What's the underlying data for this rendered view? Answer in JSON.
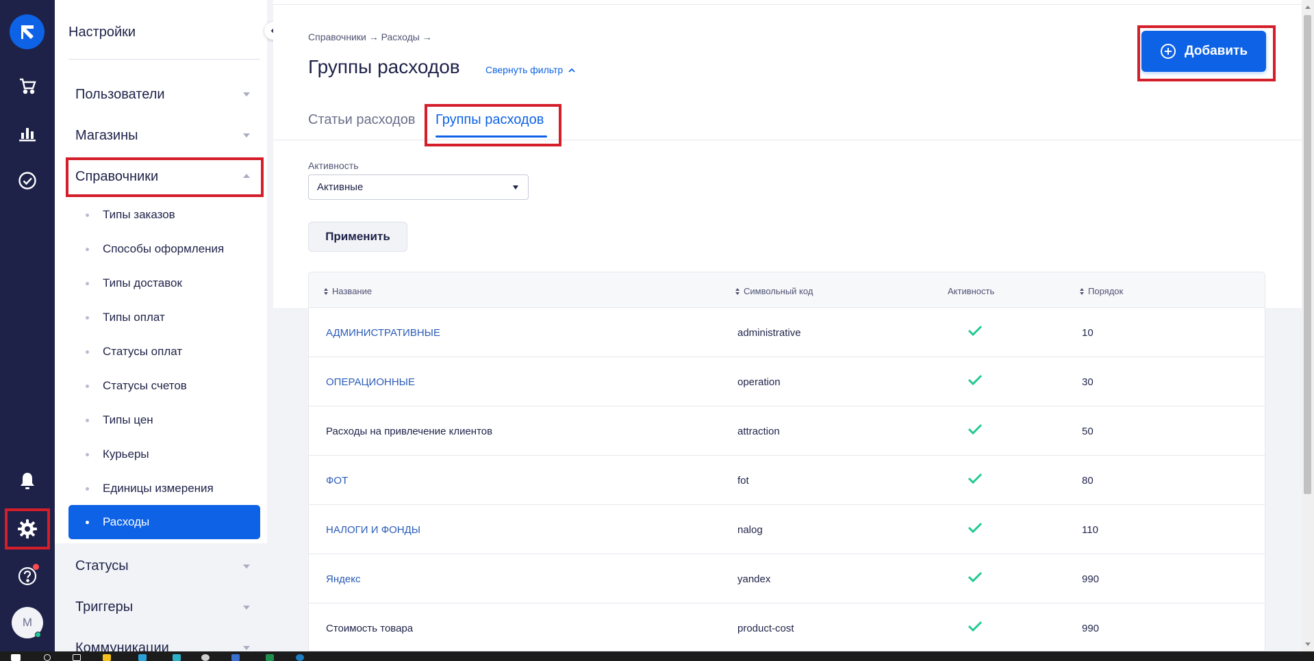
{
  "rail": {
    "items": [
      "logo-icon",
      "cart-icon",
      "chart-icon",
      "check-circle-icon",
      "bell-icon",
      "gear-icon",
      "help-icon"
    ],
    "avatar_initial": "M"
  },
  "sidebar": {
    "title": "Настройки",
    "sections": [
      {
        "label": "Пользователи",
        "expanded": false
      },
      {
        "label": "Магазины",
        "expanded": false
      },
      {
        "label": "Справочники",
        "expanded": true
      },
      {
        "label": "Статусы",
        "expanded": false
      },
      {
        "label": "Триггеры",
        "expanded": false
      },
      {
        "label": "Коммуникации",
        "expanded": false
      }
    ],
    "sub_items": [
      "Типы заказов",
      "Способы оформления",
      "Типы доставок",
      "Типы оплат",
      "Статусы оплат",
      "Статусы счетов",
      "Типы цен",
      "Курьеры",
      "Единицы измерения",
      "Расходы"
    ],
    "active_sub_item": "Расходы"
  },
  "header": {
    "breadcrumb": "Справочники → Расходы →",
    "title": "Группы расходов",
    "filter_toggle": "Свернуть фильтр",
    "add_button": "Добавить"
  },
  "tabs": [
    {
      "label": "Статьи расходов",
      "active": false
    },
    {
      "label": "Группы расходов",
      "active": true
    }
  ],
  "filter": {
    "label": "Активность",
    "selected": "Активные",
    "apply_button": "Применить"
  },
  "table": {
    "columns": [
      "Название",
      "Символьный код",
      "Активность",
      "Порядок"
    ],
    "rows": [
      {
        "name": "АДМИНИСТРАТИВНЫЕ",
        "code": "administrative",
        "active": true,
        "order": "10",
        "link": true
      },
      {
        "name": "ОПЕРАЦИОННЫЕ",
        "code": "operation",
        "active": true,
        "order": "30",
        "link": true
      },
      {
        "name": "Расходы на привлечение клиентов",
        "code": "attraction",
        "active": true,
        "order": "50",
        "link": false
      },
      {
        "name": "ФОТ",
        "code": "fot",
        "active": true,
        "order": "80",
        "link": true
      },
      {
        "name": "НАЛОГИ И ФОНДЫ",
        "code": "nalog",
        "active": true,
        "order": "110",
        "link": true
      },
      {
        "name": "Яндекс",
        "code": "yandex",
        "active": true,
        "order": "990",
        "link": true
      },
      {
        "name": "Стоимость товара",
        "code": "product-cost",
        "active": true,
        "order": "990",
        "link": false
      }
    ]
  },
  "colors": {
    "rail": "#1e2248",
    "accent": "#0d62e6",
    "highlight": "#d41e2a",
    "check": "#22c993"
  }
}
